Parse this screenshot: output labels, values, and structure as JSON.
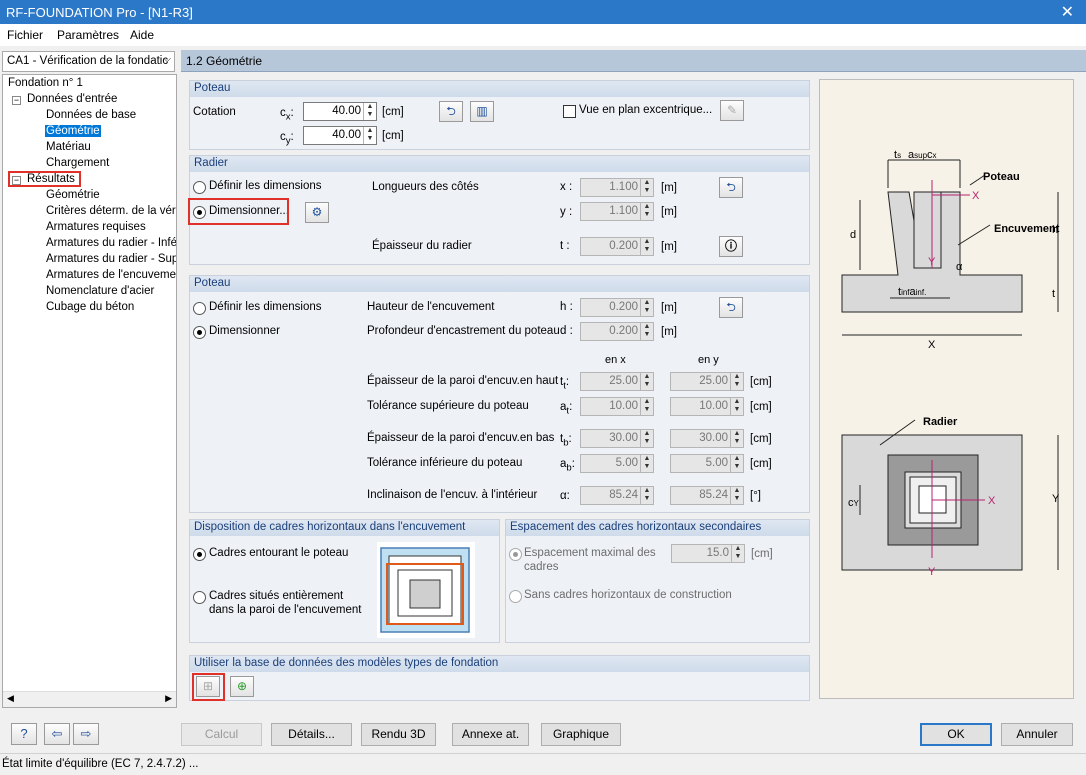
{
  "window": {
    "title": "RF-FOUNDATION Pro - [N1-R3]"
  },
  "menu": [
    "Fichier",
    "Paramètres",
    "Aide"
  ],
  "nav": {
    "case": "CA1 - Vérification de la fondatic",
    "root": "Fondation n° 1",
    "input": "Données d'entrée",
    "input_items": [
      "Données de base",
      "Géométrie",
      "Matériau",
      "Chargement"
    ],
    "results": "Résultats",
    "results_items": [
      "Géométrie",
      "Critères déterm. de la vérif",
      "Armatures requises",
      "Armatures du radier - Inféri",
      "Armatures du radier - Supé",
      "Armatures de l'encuvement",
      "Nomenclature d'acier",
      "Cubage du béton"
    ]
  },
  "section_title": "1.2 Géométrie",
  "poteau1": {
    "title": "Poteau",
    "cotation": "Cotation",
    "cx_label": "c",
    "cx_sub": "x",
    "cx_colon": ":",
    "cy_label": "c",
    "cy_sub": "y",
    "cy_colon": ":",
    "cx_value": "40.00",
    "cy_value": "40.00",
    "unit_cm": "[cm]",
    "excentric": "Vue en plan excentrique..."
  },
  "radier": {
    "title": "Radier",
    "def": "Définir les dimensions",
    "dim": "Dimensionner...",
    "lengths": "Longueurs des côtés",
    "x_label": "x :",
    "y_label": "y :",
    "x_val": "1.100",
    "y_val": "1.100",
    "unit_m": "[m]",
    "thick": "Épaisseur du radier",
    "t_label": "t :",
    "t_val": "0.200"
  },
  "poteau2": {
    "title": "Poteau",
    "def": "Définir les dimensions",
    "dim": "Dimensionner",
    "h_text": "Hauteur de l'encuvement",
    "h_label": "h :",
    "h_val": "0.200",
    "d_text": "Profondeur d'encastrement du poteau",
    "d_label": "d :",
    "d_val": "0.200",
    "unit_m": "[m]",
    "unit_cm": "[cm]",
    "unit_deg": "[°]",
    "enx": "en x",
    "eny": "en y",
    "rows": [
      {
        "text": "Épaisseur de la paroi d'encuv.en haut",
        "sym": "t",
        "sub": "t",
        "vx": "25.00",
        "vy": "25.00",
        "unit": "[cm]"
      },
      {
        "text": "Tolérance supérieure du poteau",
        "sym": "a",
        "sub": "t",
        "vx": "10.00",
        "vy": "10.00",
        "unit": "[cm]"
      },
      {
        "text": "Épaisseur de la paroi d'encuv.en bas",
        "sym": "t",
        "sub": "b",
        "vx": "30.00",
        "vy": "30.00",
        "unit": "[cm]"
      },
      {
        "text": "Tolérance inférieure du poteau",
        "sym": "a",
        "sub": "b",
        "vx": "5.00",
        "vy": "5.00",
        "unit": "[cm]"
      },
      {
        "text": "Inclinaison de l'encuv. à l'intérieur",
        "sym": "α",
        "sub": "",
        "vx": "85.24",
        "vy": "85.24",
        "unit": "[°]"
      }
    ]
  },
  "cadres": {
    "title": "Disposition de cadres horizontaux dans l'encuvement",
    "opt1": "Cadres entourant le poteau",
    "opt2a": "Cadres situés entièrement",
    "opt2b": "dans la paroi de l'encuvement"
  },
  "espacement": {
    "title": "Espacement des cadres horizontaux secondaires",
    "opt1a": "Espacement maximal des",
    "opt1b": "cadres",
    "val": "15.0",
    "unit": "[cm]",
    "opt2": "Sans cadres horizontaux de construction"
  },
  "database": {
    "title": "Utiliser la base de données des modèles types de fondation"
  },
  "figure": {
    "poteau": "Poteau",
    "encuvement": "Encuvement",
    "radier": "Radier",
    "X": "X",
    "Y": "Y",
    "d": "d",
    "h": "h",
    "t": "t",
    "ts": "t",
    "ts_sub": "s",
    "asup": "a",
    "asup_sub": "sup",
    "cx": "c",
    "cx_sub": "x",
    "tinf": "t",
    "tinf_sub": "inf",
    "ainf": "a",
    "ainf_sub": "inf.",
    "alpha": "α",
    "cy": "c",
    "cy_sub": "Y"
  },
  "buttons": {
    "calcul": "Calcul",
    "details": "Détails...",
    "rendu": "Rendu 3D",
    "annexe": "Annexe at.",
    "graphique": "Graphique",
    "ok": "OK",
    "annuler": "Annuler"
  },
  "status": "État limite d'équilibre (EC 7, 2.4.7.2) ..."
}
